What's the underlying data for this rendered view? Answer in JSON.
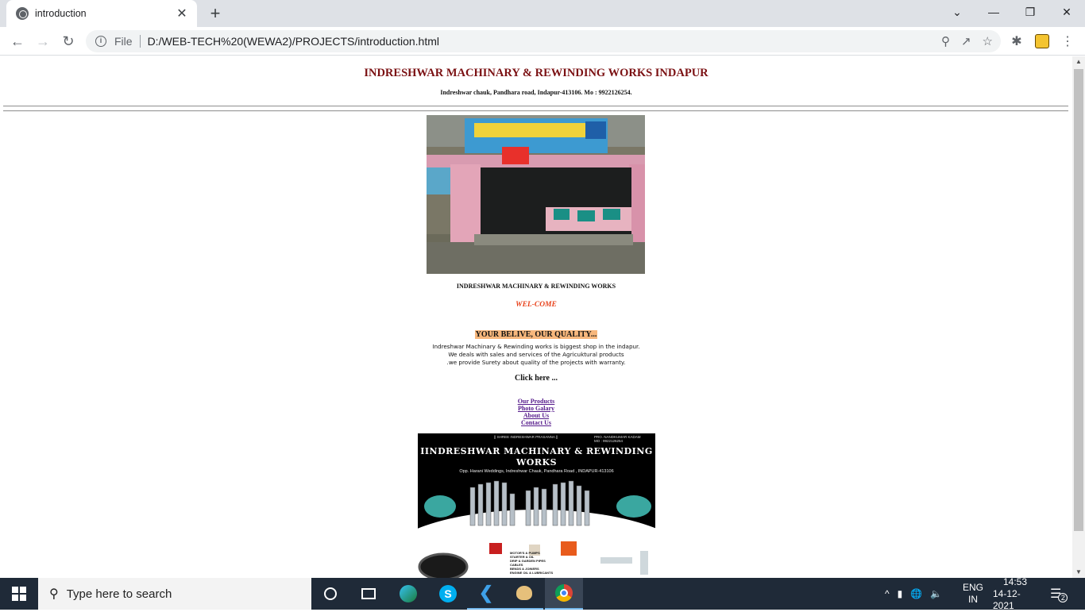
{
  "browser": {
    "tab_title": "introduction",
    "new_tab": "+",
    "file_label": "File",
    "url": "D:/WEB-TECH%20(WEWA2)/PROJECTS/introduction.html"
  },
  "page": {
    "title": "INDRESHWAR MACHINARY & REWINDING WORKS INDAPUR",
    "address": "Indreshwar chauk, Pandhara road, Indapur-413106. Mo : 9922126254.",
    "subtitle": "INDRESHWAR MACHINARY & REWINDING WORKS",
    "welcome": "WEL-COME",
    "slogan": "YOUR BELIVE, OUR QUALITY...",
    "description": [
      "Indreshwar Machinary & Rewinding works is biggest shop in the indapur.",
      "We deals with sales and services of the Agricuktural products",
      ".we provide Surety about quality of the projects with warranty."
    ],
    "click_here": "Click here ...",
    "links": [
      "Our Products",
      "Photo Galary",
      "About Us",
      "Contact Us"
    ],
    "banner": {
      "top_left": "|| SHREE INDRESHWAR PRASANNA ||",
      "top_right_1": "PRO. NANDKUMAR KADAM",
      "top_right_2": "MO : 9922126254",
      "title_1": "IINDRESHWAR MACHINARY & REWINDING",
      "title_2": "WORKS",
      "address": "Opp. Harani  Weddings, Indreshwar Chauk, Pandhara Road , INDAPUR-413106",
      "list": [
        "MOTOR'S & PUMPS",
        "STARTER & OIL",
        "DRIP & GARDEN PIPES",
        "CABLES",
        "BENDS & JOINERS",
        "ENGINE OIL & LUBRICANTS"
      ]
    }
  },
  "taskbar": {
    "search_placeholder": "Type here to search",
    "lang_1": "ENG",
    "lang_2": "IN",
    "time": "14:53",
    "date": "14-12-2021",
    "notifications": "2"
  }
}
